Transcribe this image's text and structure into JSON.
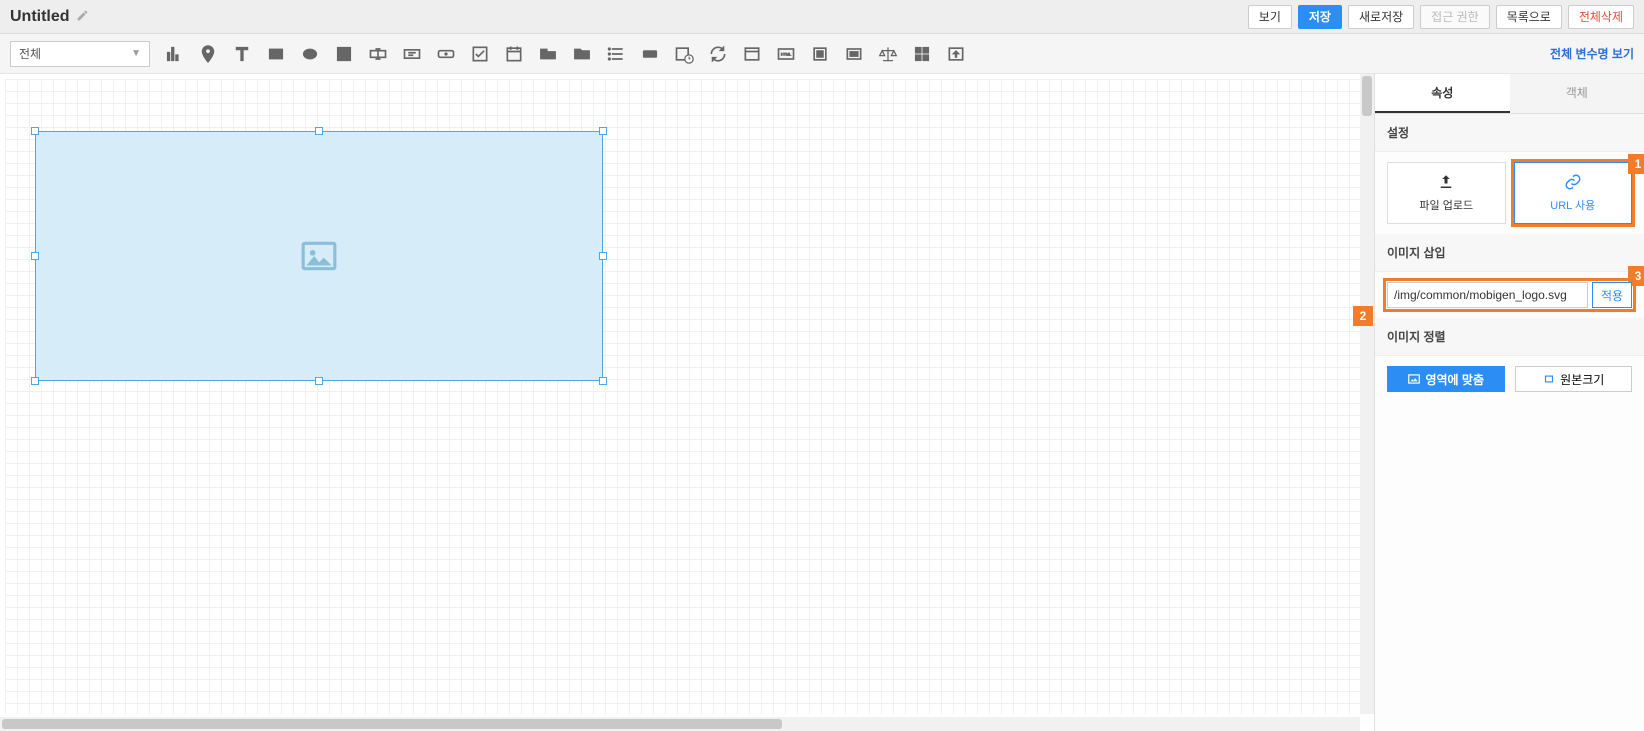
{
  "header": {
    "title": "Untitled",
    "buttons": {
      "view": "보기",
      "save": "저장",
      "save_as": "새로저장",
      "access": "접근 권한",
      "list": "목록으로",
      "delete_all": "전체삭제"
    }
  },
  "toolbar": {
    "dropdown": "전체",
    "var_link": "전체 변수명 보기"
  },
  "panel": {
    "tabs": {
      "props": "속성",
      "objects": "객체"
    },
    "sect_settings": "설정",
    "tile_upload": "파일 업로드",
    "tile_url": "URL 사용",
    "sect_insert": "이미지 삽입",
    "url_value": "/img/common/mobigen_logo.svg",
    "apply": "적용",
    "sect_align": "이미지 정렬",
    "align_fit": "영역에 맞춤",
    "align_orig": "원본크기",
    "callouts": {
      "c1": "1",
      "c2": "2",
      "c3": "3"
    }
  }
}
